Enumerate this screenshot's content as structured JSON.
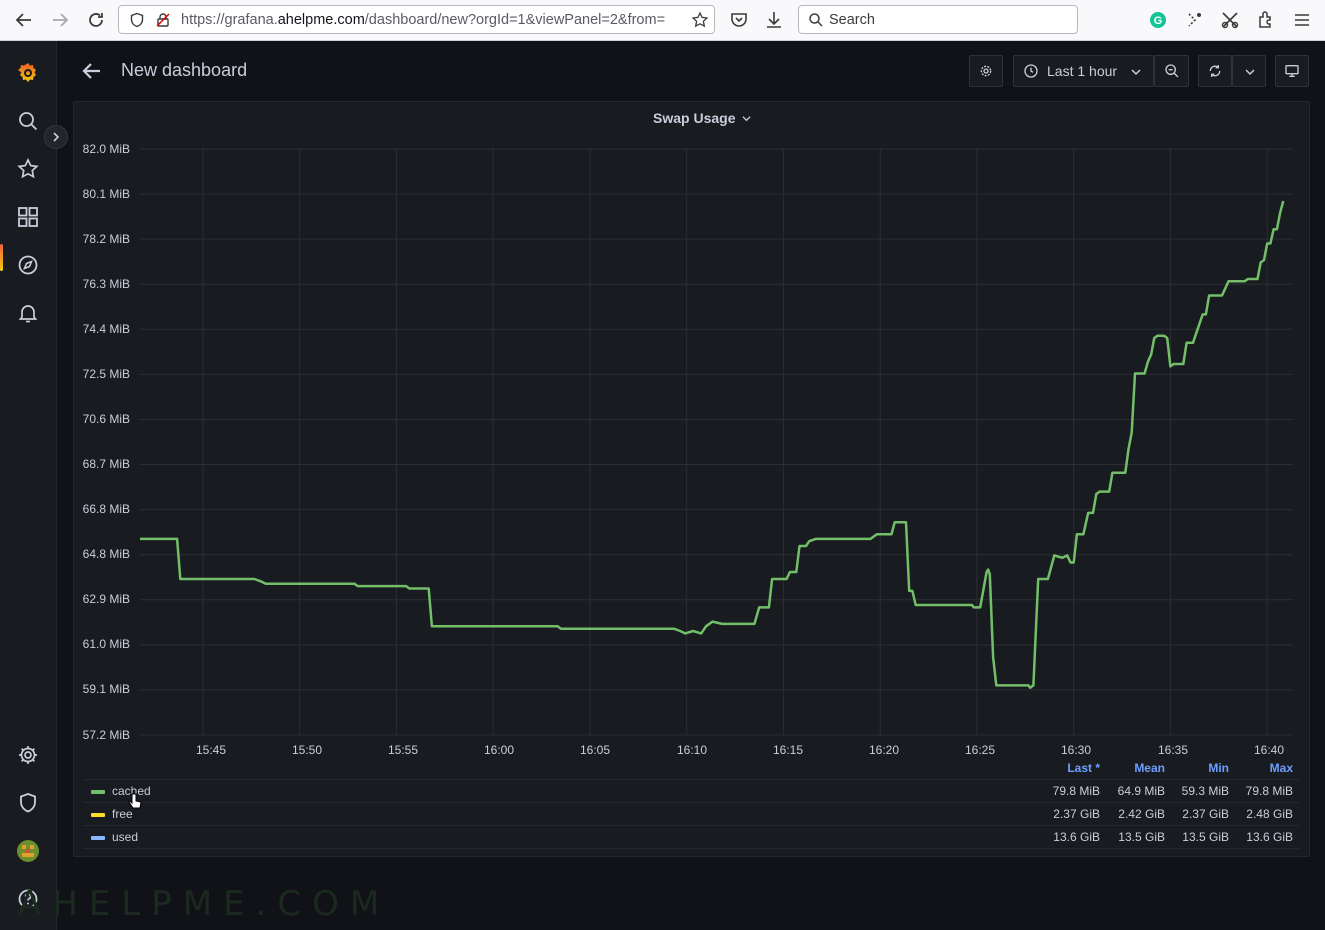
{
  "browser": {
    "url_prefix": "https://grafana.",
    "url_domain": "ahelpme.com",
    "url_suffix": "/dashboard/new?orgId=1&viewPanel=2&from=",
    "search_placeholder": "Search"
  },
  "sidebar": {
    "items": [
      "grafana-logo",
      "search",
      "starred",
      "dashboards",
      "explore",
      "alerting",
      "configuration",
      "server-admin",
      "profile",
      "help"
    ],
    "active": "dashboards"
  },
  "header": {
    "title": "New dashboard",
    "time_range": "Last 1 hour"
  },
  "panel": {
    "title": "Swap Usage"
  },
  "chart_data": {
    "type": "line",
    "title": "Swap Usage",
    "ylabel": "",
    "xlabel": "",
    "y_ticks": [
      "82.0 MiB",
      "80.1 MiB",
      "78.2 MiB",
      "76.3 MiB",
      "74.4 MiB",
      "72.5 MiB",
      "70.6 MiB",
      "68.7 MiB",
      "66.8 MiB",
      "64.8 MiB",
      "62.9 MiB",
      "61.0 MiB",
      "59.1 MiB",
      "57.2 MiB"
    ],
    "x_ticks": [
      "15:45",
      "15:50",
      "15:55",
      "16:00",
      "16:05",
      "16:10",
      "16:15",
      "16:20",
      "16:25",
      "16:30",
      "16:35",
      "16:40"
    ],
    "ylim": [
      57.2,
      82.0
    ],
    "xlim": [
      "15:41:45",
      "16:41:20"
    ],
    "grid": true,
    "legend_placement": "bottom",
    "series": [
      {
        "name": "cached",
        "color": "#73bf69",
        "points": [
          [
            "15:41:45",
            65.5
          ],
          [
            "15:43:40",
            65.5
          ],
          [
            "15:43:50",
            63.8
          ],
          [
            "15:47:40",
            63.8
          ],
          [
            "15:48:00",
            63.7
          ],
          [
            "15:48:15",
            63.6
          ],
          [
            "15:52:50",
            63.6
          ],
          [
            "15:53:00",
            63.5
          ],
          [
            "15:55:30",
            63.5
          ],
          [
            "15:55:40",
            63.4
          ],
          [
            "15:56:40",
            63.4
          ],
          [
            "15:56:50",
            61.8
          ],
          [
            "16:00:00",
            61.8
          ],
          [
            "16:03:20",
            61.8
          ],
          [
            "16:03:30",
            61.7
          ],
          [
            "16:09:20",
            61.7
          ],
          [
            "16:09:40",
            61.6
          ],
          [
            "16:09:55",
            61.5
          ],
          [
            "16:10:20",
            61.6
          ],
          [
            "16:10:45",
            61.5
          ],
          [
            "16:11:00",
            61.8
          ],
          [
            "16:11:20",
            62.0
          ],
          [
            "16:11:50",
            61.9
          ],
          [
            "16:13:30",
            61.9
          ],
          [
            "16:13:45",
            62.6
          ],
          [
            "16:14:15",
            62.6
          ],
          [
            "16:14:25",
            63.8
          ],
          [
            "16:15:10",
            63.8
          ],
          [
            "16:15:20",
            64.1
          ],
          [
            "16:15:40",
            64.1
          ],
          [
            "16:15:50",
            65.2
          ],
          [
            "16:16:10",
            65.2
          ],
          [
            "16:16:20",
            65.4
          ],
          [
            "16:16:40",
            65.5
          ],
          [
            "16:19:30",
            65.5
          ],
          [
            "16:19:40",
            65.6
          ],
          [
            "16:19:50",
            65.7
          ],
          [
            "16:20:35",
            65.7
          ],
          [
            "16:20:45",
            66.2
          ],
          [
            "16:21:20",
            66.2
          ],
          [
            "16:21:30",
            63.3
          ],
          [
            "16:21:40",
            63.3
          ],
          [
            "16:21:50",
            62.7
          ],
          [
            "16:24:45",
            62.7
          ],
          [
            "16:24:50",
            62.6
          ],
          [
            "16:25:10",
            62.6
          ],
          [
            "16:25:30",
            64.1
          ],
          [
            "16:25:35",
            64.2
          ],
          [
            "16:25:40",
            64.0
          ],
          [
            "16:25:50",
            60.5
          ],
          [
            "16:26:00",
            59.3
          ],
          [
            "16:27:40",
            59.3
          ],
          [
            "16:27:45",
            59.2
          ],
          [
            "16:27:55",
            59.3
          ],
          [
            "16:28:10",
            63.8
          ],
          [
            "16:28:40",
            63.8
          ],
          [
            "16:29:00",
            64.8
          ],
          [
            "16:29:25",
            64.7
          ],
          [
            "16:29:40",
            64.8
          ],
          [
            "16:29:50",
            64.5
          ],
          [
            "16:30:00",
            64.5
          ],
          [
            "16:30:10",
            65.7
          ],
          [
            "16:30:30",
            65.7
          ],
          [
            "16:30:45",
            66.6
          ],
          [
            "16:31:00",
            66.6
          ],
          [
            "16:31:10",
            67.4
          ],
          [
            "16:31:20",
            67.5
          ],
          [
            "16:31:50",
            67.5
          ],
          [
            "16:32:00",
            68.3
          ],
          [
            "16:32:40",
            68.3
          ],
          [
            "16:32:50",
            69.3
          ],
          [
            "16:33:00",
            70.0
          ],
          [
            "16:33:10",
            72.5
          ],
          [
            "16:33:20",
            72.5
          ],
          [
            "16:33:40",
            72.5
          ],
          [
            "16:33:50",
            73.0
          ],
          [
            "16:34:00",
            73.3
          ],
          [
            "16:34:10",
            74.0
          ],
          [
            "16:34:20",
            74.1
          ],
          [
            "16:34:40",
            74.1
          ],
          [
            "16:34:50",
            74.0
          ],
          [
            "16:35:00",
            72.8
          ],
          [
            "16:35:10",
            72.9
          ],
          [
            "16:35:40",
            72.9
          ],
          [
            "16:35:50",
            73.8
          ],
          [
            "16:36:10",
            73.8
          ],
          [
            "16:36:20",
            74.2
          ],
          [
            "16:36:40",
            75.0
          ],
          [
            "16:36:50",
            75.0
          ],
          [
            "16:37:00",
            75.8
          ],
          [
            "16:37:40",
            75.8
          ],
          [
            "16:38:00",
            76.4
          ],
          [
            "16:38:50",
            76.4
          ],
          [
            "16:39:00",
            76.5
          ],
          [
            "16:39:30",
            76.5
          ],
          [
            "16:39:40",
            77.2
          ],
          [
            "16:39:50",
            77.3
          ],
          [
            "16:40:00",
            78.0
          ],
          [
            "16:40:10",
            78.0
          ],
          [
            "16:40:20",
            78.6
          ],
          [
            "16:40:30",
            78.6
          ],
          [
            "16:40:40",
            79.3
          ],
          [
            "16:40:50",
            79.8
          ]
        ],
        "legend": {
          "last": "79.8 MiB",
          "mean": "64.9 MiB",
          "min": "59.3 MiB",
          "max": "79.8 MiB"
        }
      },
      {
        "name": "free",
        "color": "#fade2a",
        "legend": {
          "last": "2.37 GiB",
          "mean": "2.42 GiB",
          "min": "2.37 GiB",
          "max": "2.48 GiB"
        }
      },
      {
        "name": "used",
        "color": "#8ab8ff",
        "legend": {
          "last": "13.6 GiB",
          "mean": "13.5 GiB",
          "min": "13.5 GiB",
          "max": "13.6 GiB"
        }
      }
    ],
    "legend_columns": [
      "Last *",
      "Mean",
      "Min",
      "Max"
    ]
  },
  "watermark": "AHELPME.COM"
}
